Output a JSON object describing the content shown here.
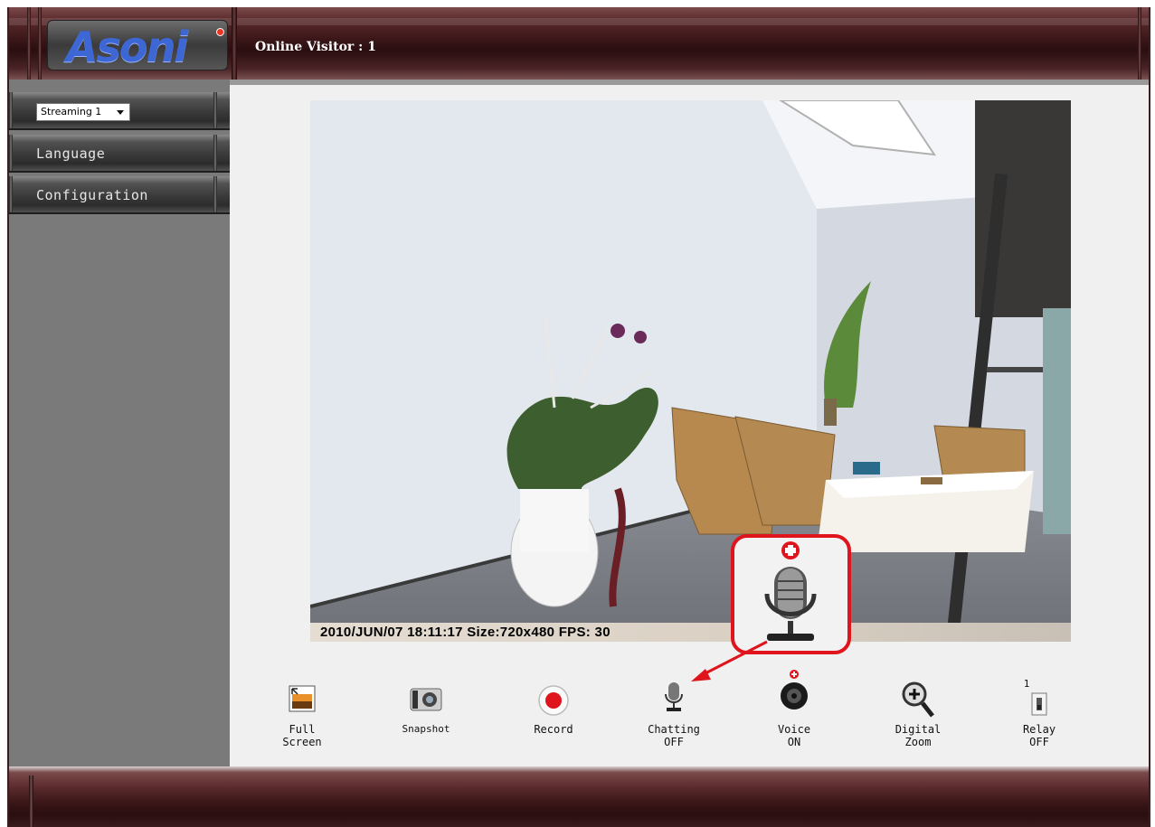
{
  "header": {
    "logo_text": "Asoni",
    "online_visitor": "Online Visitor : 1"
  },
  "sidebar": {
    "stream_select": {
      "value": "Streaming 1"
    },
    "items": [
      {
        "label": "Language"
      },
      {
        "label": "Configuration"
      }
    ]
  },
  "video": {
    "overlay": "2010/JUN/07 18:11:17 Size:720x480 FPS: 30"
  },
  "toolbar": {
    "full_screen": [
      "Full",
      "Screen"
    ],
    "snapshot": "Snapshot",
    "record": "Record",
    "chatting": [
      "Chatting",
      "OFF"
    ],
    "voice": [
      "Voice",
      "ON"
    ],
    "digital_zoom": [
      "Digital",
      "Zoom"
    ],
    "relay": [
      "Relay",
      "OFF"
    ],
    "relay_index": "1"
  },
  "colors": {
    "header_dark": "#2a0e10",
    "header_mid": "#5a2a2c",
    "sidebar_bg": "#7a7a7a",
    "content_bg": "#f0f0f0",
    "callout_red": "#e0141c",
    "logo_blue": "#3e67d6"
  }
}
